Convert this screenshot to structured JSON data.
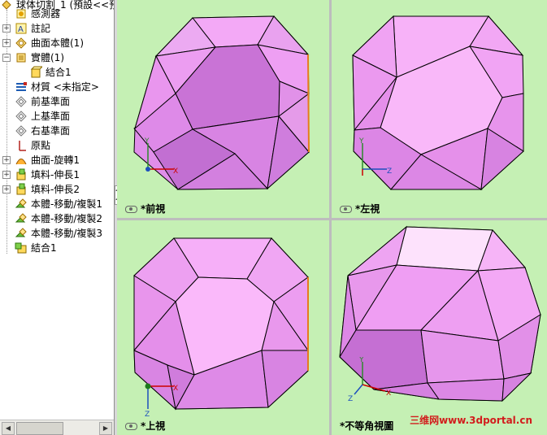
{
  "tree": {
    "root_label": "球体切割_1 (預設<<預",
    "items": [
      {
        "label": "感測器",
        "icon": "sensor-icon",
        "expander": ""
      },
      {
        "label": "註記",
        "icon": "annotation-icon",
        "expander": "+"
      },
      {
        "label": "曲面本體(1)",
        "icon": "surface-bodies-icon",
        "expander": "+"
      },
      {
        "label": "實體(1)",
        "icon": "solid-bodies-icon",
        "expander": "-"
      },
      {
        "label": "結合1",
        "icon": "combine-body-icon",
        "expander": ""
      },
      {
        "label": "材質 <未指定>",
        "icon": "material-icon",
        "expander": ""
      },
      {
        "label": "前基準面",
        "icon": "plane-icon",
        "expander": ""
      },
      {
        "label": "上基準面",
        "icon": "plane-icon",
        "expander": ""
      },
      {
        "label": "右基準面",
        "icon": "plane-icon",
        "expander": ""
      },
      {
        "label": "原點",
        "icon": "origin-icon",
        "expander": ""
      },
      {
        "label": "曲面-旋轉1",
        "icon": "surface-revolve-icon",
        "expander": "+"
      },
      {
        "label": "填料-伸長1",
        "icon": "boss-extrude-icon",
        "expander": "+"
      },
      {
        "label": "填料-伸長2",
        "icon": "boss-extrude-icon",
        "expander": "+"
      },
      {
        "label": "本體-移動/複製1",
        "icon": "move-copy-body-icon",
        "expander": ""
      },
      {
        "label": "本體-移動/複製2",
        "icon": "move-copy-body-icon",
        "expander": ""
      },
      {
        "label": "本體-移動/複製3",
        "icon": "move-copy-body-icon",
        "expander": ""
      },
      {
        "label": "結合1",
        "icon": "combine-feature-icon",
        "expander": ""
      }
    ]
  },
  "viewports": [
    {
      "title": "*前視",
      "axes": [
        "Y",
        "X"
      ]
    },
    {
      "title": "*左視",
      "axes": [
        "Y",
        "Z"
      ]
    },
    {
      "title": "*上視",
      "axes": [
        "X",
        "Z"
      ]
    },
    {
      "title": "*不等角視圖",
      "axes": [
        "Y",
        "X",
        "Z"
      ]
    }
  ],
  "watermark": "三维网www.3dportal.cn",
  "colors": {
    "viewport_bg": "#c5f0b4",
    "face_light": "#f0a8f3",
    "face_mid": "#e08eea",
    "face_dark": "#c472d6",
    "face_top": "#fbdcfb",
    "edge_orange": "#e57d1b"
  }
}
